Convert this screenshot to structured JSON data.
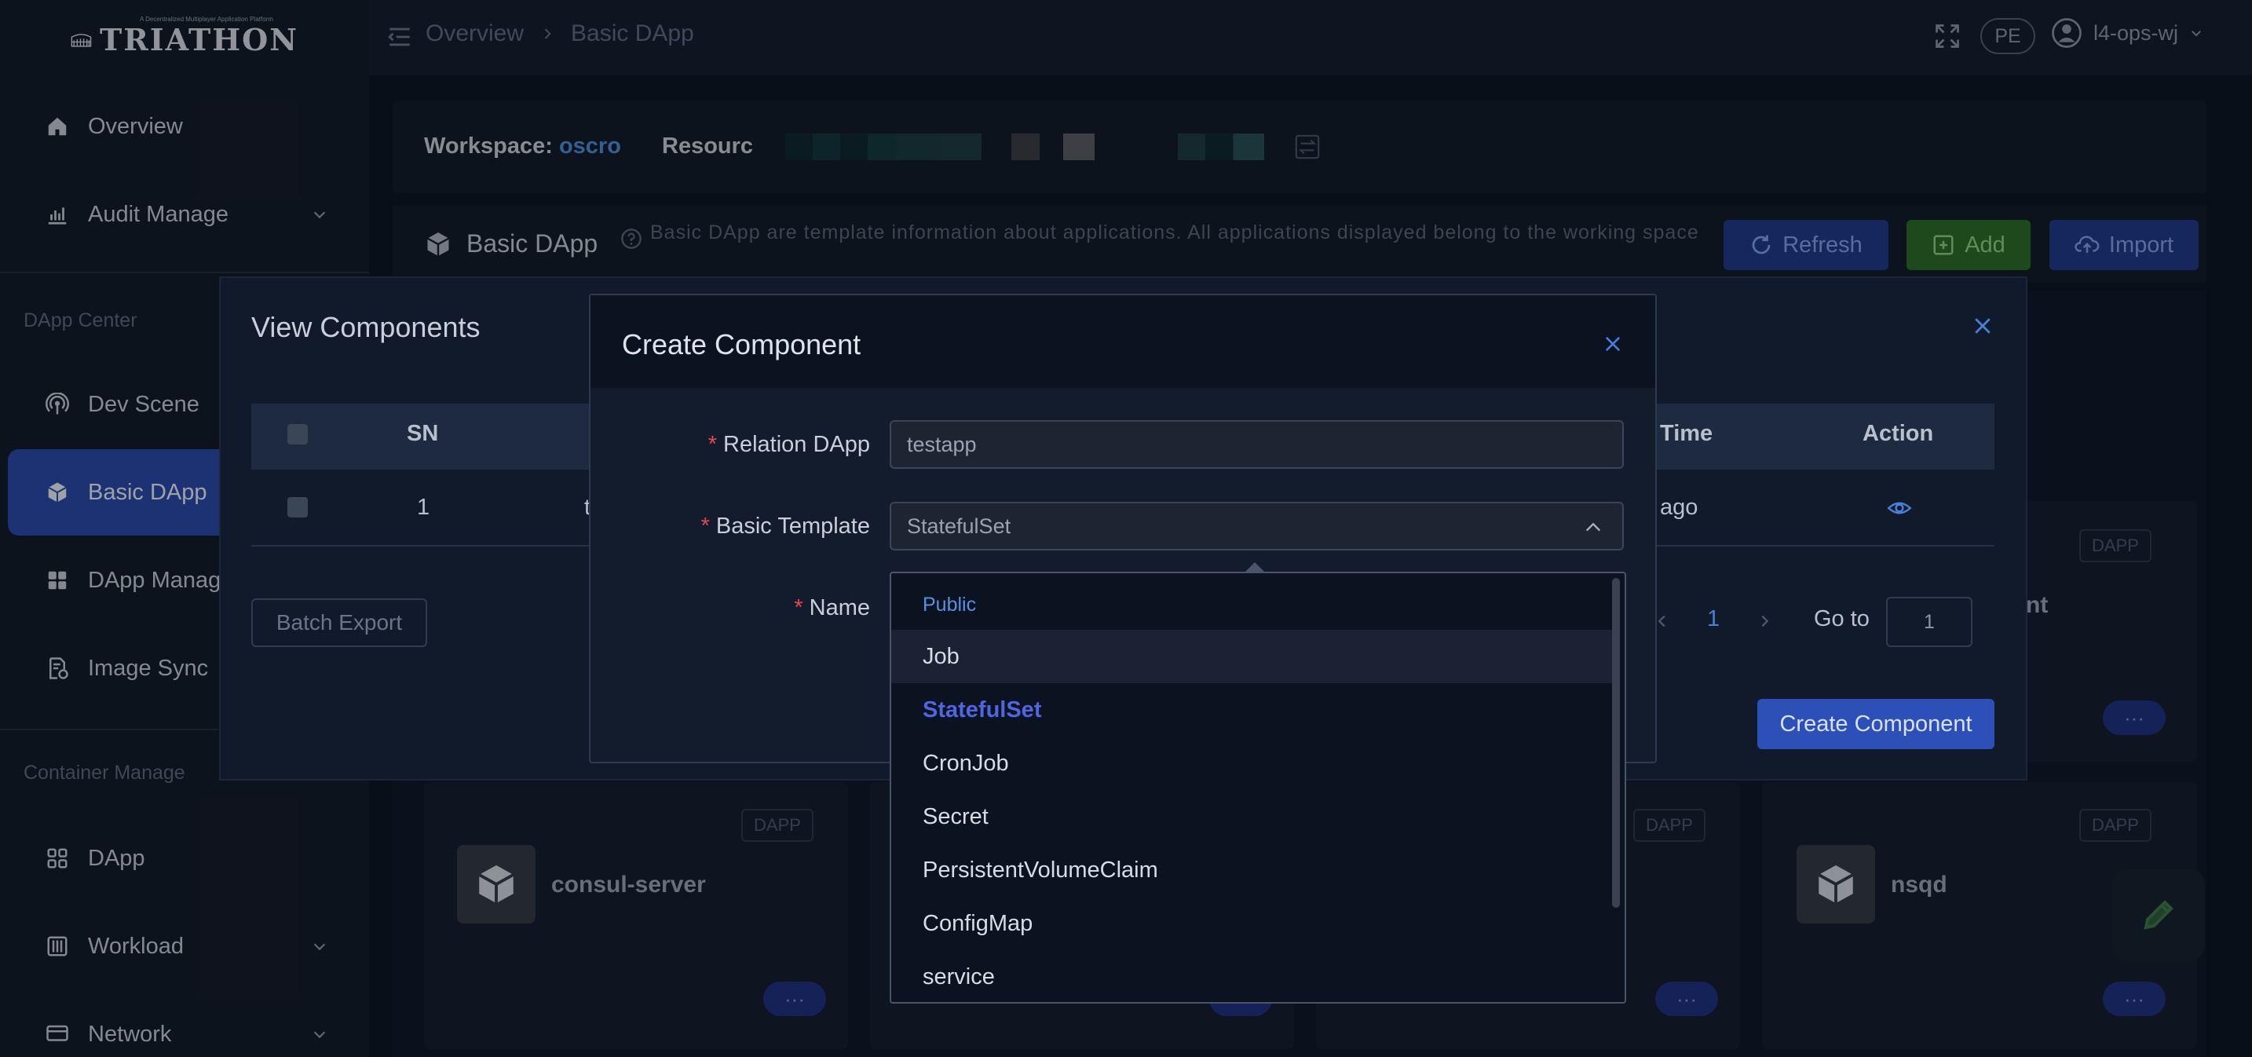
{
  "app": {
    "logo_text": "TRIATHON",
    "logo_subtitle": "A Decentralized Multiplayer Application Platform"
  },
  "header": {
    "breadcrumb": [
      "Overview",
      "Basic DApp"
    ],
    "badge": "PE",
    "user_name": "l4-ops-wj"
  },
  "sidebar": {
    "items_top": [
      {
        "label": "Overview",
        "icon": "home-icon"
      },
      {
        "label": "Audit Manage",
        "icon": "chart-icon",
        "expandable": true
      }
    ],
    "section_dapp": "DApp Center",
    "items_dapp": [
      {
        "label": "Dev Scene",
        "icon": "broadcast-icon"
      },
      {
        "label": "Basic DApp",
        "icon": "cube-icon",
        "active": true
      },
      {
        "label": "DApp Manag",
        "icon": "grid-icon"
      },
      {
        "label": "Image Sync",
        "icon": "document-sync-icon"
      }
    ],
    "section_container": "Container Manage",
    "items_container": [
      {
        "label": "DApp",
        "icon": "apps-icon"
      },
      {
        "label": "Workload",
        "icon": "sliders-icon",
        "expandable": true
      },
      {
        "label": "Network",
        "icon": "network-icon",
        "expandable": true
      }
    ]
  },
  "workspace": {
    "label": "Workspace:",
    "value": "oscro",
    "resource_label": "Resourc"
  },
  "panel": {
    "title": "Basic DApp",
    "description": "Basic DApp are template information about applications. All applications displayed belong to the working space",
    "refresh": "Refresh",
    "add": "Add",
    "import": "Import"
  },
  "cards": {
    "tag": "DAPP",
    "partial_name": "nt",
    "names": [
      "consul-server",
      "nsqd"
    ]
  },
  "view_dialog": {
    "title": "View Components",
    "columns": {
      "sn": "SN",
      "time": "Time",
      "action": "Action"
    },
    "rows": [
      {
        "sn": "1",
        "name_partial": "t",
        "time_partial": "ago"
      }
    ],
    "batch_export": "Batch Export",
    "current_page": "1",
    "goto_label": "Go to",
    "goto_value": "1",
    "create_button": "Create Component"
  },
  "create_dialog": {
    "title": "Create Component",
    "relation_label": "Relation DApp",
    "relation_value": "testapp",
    "template_label": "Basic Template",
    "template_value": "StatefulSet",
    "name_label": "Name"
  },
  "dropdown": {
    "group": "Public",
    "options": [
      "Job",
      "StatefulSet",
      "CronJob",
      "Secret",
      "PersistentVolumeClaim",
      "ConfigMap",
      "service"
    ],
    "hovered": "Job",
    "selected": "StatefulSet"
  },
  "colors": {
    "accent": "#2b4aa8",
    "selected_option": "#4f66e0",
    "required": "#e5484d"
  }
}
